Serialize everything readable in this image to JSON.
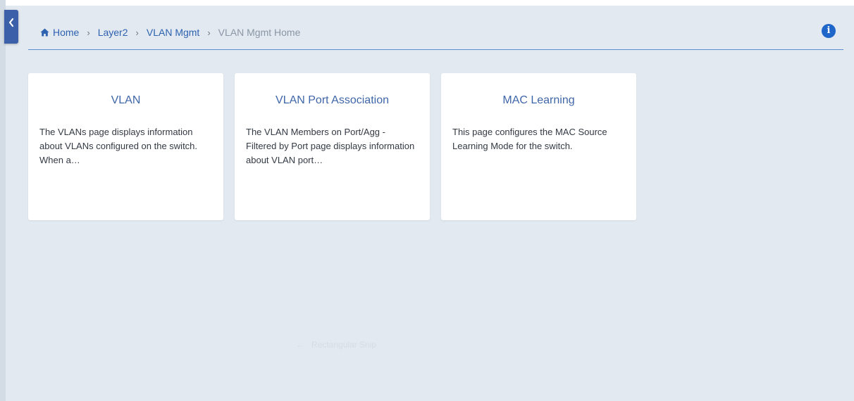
{
  "breadcrumb": {
    "items": [
      {
        "label": "Home",
        "current": false
      },
      {
        "label": "Layer2",
        "current": false
      },
      {
        "label": "VLAN Mgmt",
        "current": false
      },
      {
        "label": "VLAN Mgmt Home",
        "current": true
      }
    ],
    "separator": "›"
  },
  "cards": [
    {
      "title": "VLAN",
      "description": "The VLANs page displays information about VLANs configured on the switch. When a…"
    },
    {
      "title": "VLAN Port Association",
      "description": "The VLAN Members on Port/Agg - Filtered by Port page displays information about VLAN port…"
    },
    {
      "title": "MAC Learning",
      "description": "This page configures the MAC Source Learning Mode for the switch."
    }
  ],
  "footer_hint": {
    "arrow": "←",
    "label": "Rectangular Snip"
  },
  "icons": {
    "collapse": "chevron-left-icon",
    "home": "home-icon",
    "info": "info-icon"
  },
  "colors": {
    "accent": "#3b5fa8",
    "link": "#2d62b0",
    "background": "#e3e9f0",
    "info": "#1f66c9"
  }
}
